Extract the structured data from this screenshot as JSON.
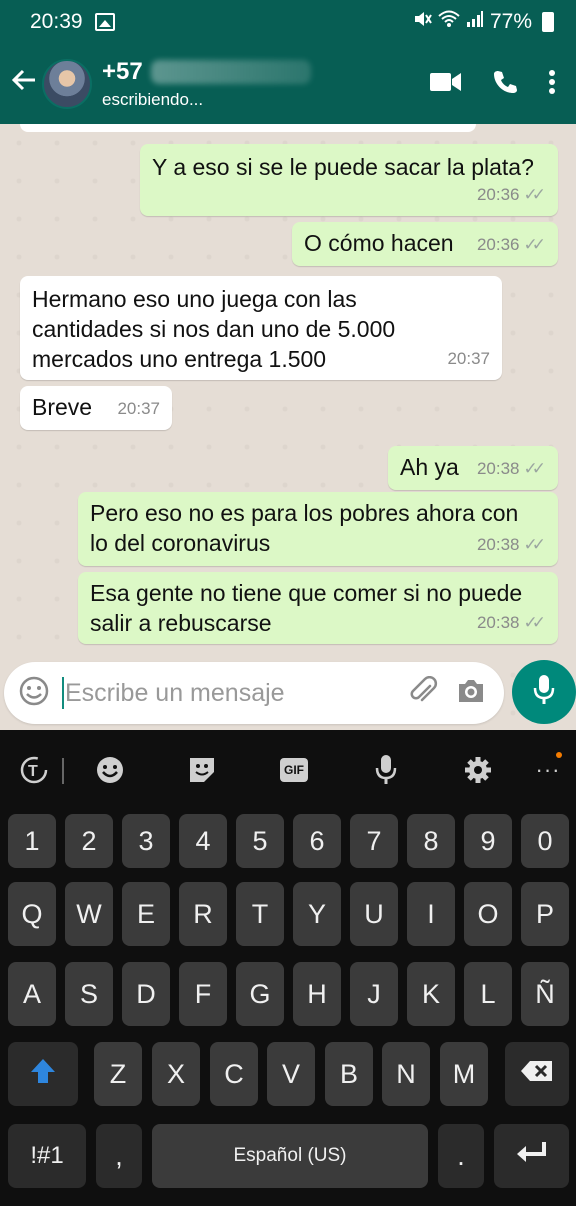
{
  "status_bar": {
    "time": "20:39",
    "battery": "77%"
  },
  "header": {
    "contact_number": "+57",
    "typing_status": "escribiendo..."
  },
  "messages": [
    {
      "dir": "out",
      "lines": [
        "Y a eso si se le puede sacar la plata?"
      ],
      "time": "20:36"
    },
    {
      "dir": "out",
      "lines": [
        "O cómo hacen"
      ],
      "time": "20:36"
    },
    {
      "dir": "in",
      "lines": [
        "Hermano eso uno juega con las",
        "cantidades si nos dan uno de 5.000",
        "mercados uno entrega 1.500"
      ],
      "time": "20:37"
    },
    {
      "dir": "in",
      "lines": [
        "Breve"
      ],
      "time": "20:37"
    },
    {
      "dir": "out",
      "lines": [
        "Ah ya"
      ],
      "time": "20:38"
    },
    {
      "dir": "out",
      "lines": [
        "Pero eso no es para los pobres ahora con",
        "lo del coronavirus"
      ],
      "time": "20:38"
    },
    {
      "dir": "out",
      "lines": [
        "Esa gente no tiene que comer si no puede",
        "salir a rebuscarse"
      ],
      "time": "20:38"
    }
  ],
  "input": {
    "placeholder": "Escribe un mensaje"
  },
  "keyboard": {
    "row_numbers": [
      "1",
      "2",
      "3",
      "4",
      "5",
      "6",
      "7",
      "8",
      "9",
      "0"
    ],
    "row_top": [
      "Q",
      "W",
      "E",
      "R",
      "T",
      "Y",
      "U",
      "I",
      "O",
      "P"
    ],
    "row_middle": [
      "A",
      "S",
      "D",
      "F",
      "G",
      "H",
      "J",
      "K",
      "L",
      "Ñ"
    ],
    "row_bottom": [
      "Z",
      "X",
      "C",
      "V",
      "B",
      "N",
      "M"
    ],
    "symbols_key": "!#1",
    "comma_key": ",",
    "space_label": "Español (US)",
    "period_key": ".",
    "gif_label": "GIF"
  },
  "colors": {
    "header": "#075E54",
    "outgoing": "#dcf8c6",
    "incoming": "#ffffff",
    "fab": "#00897B"
  }
}
